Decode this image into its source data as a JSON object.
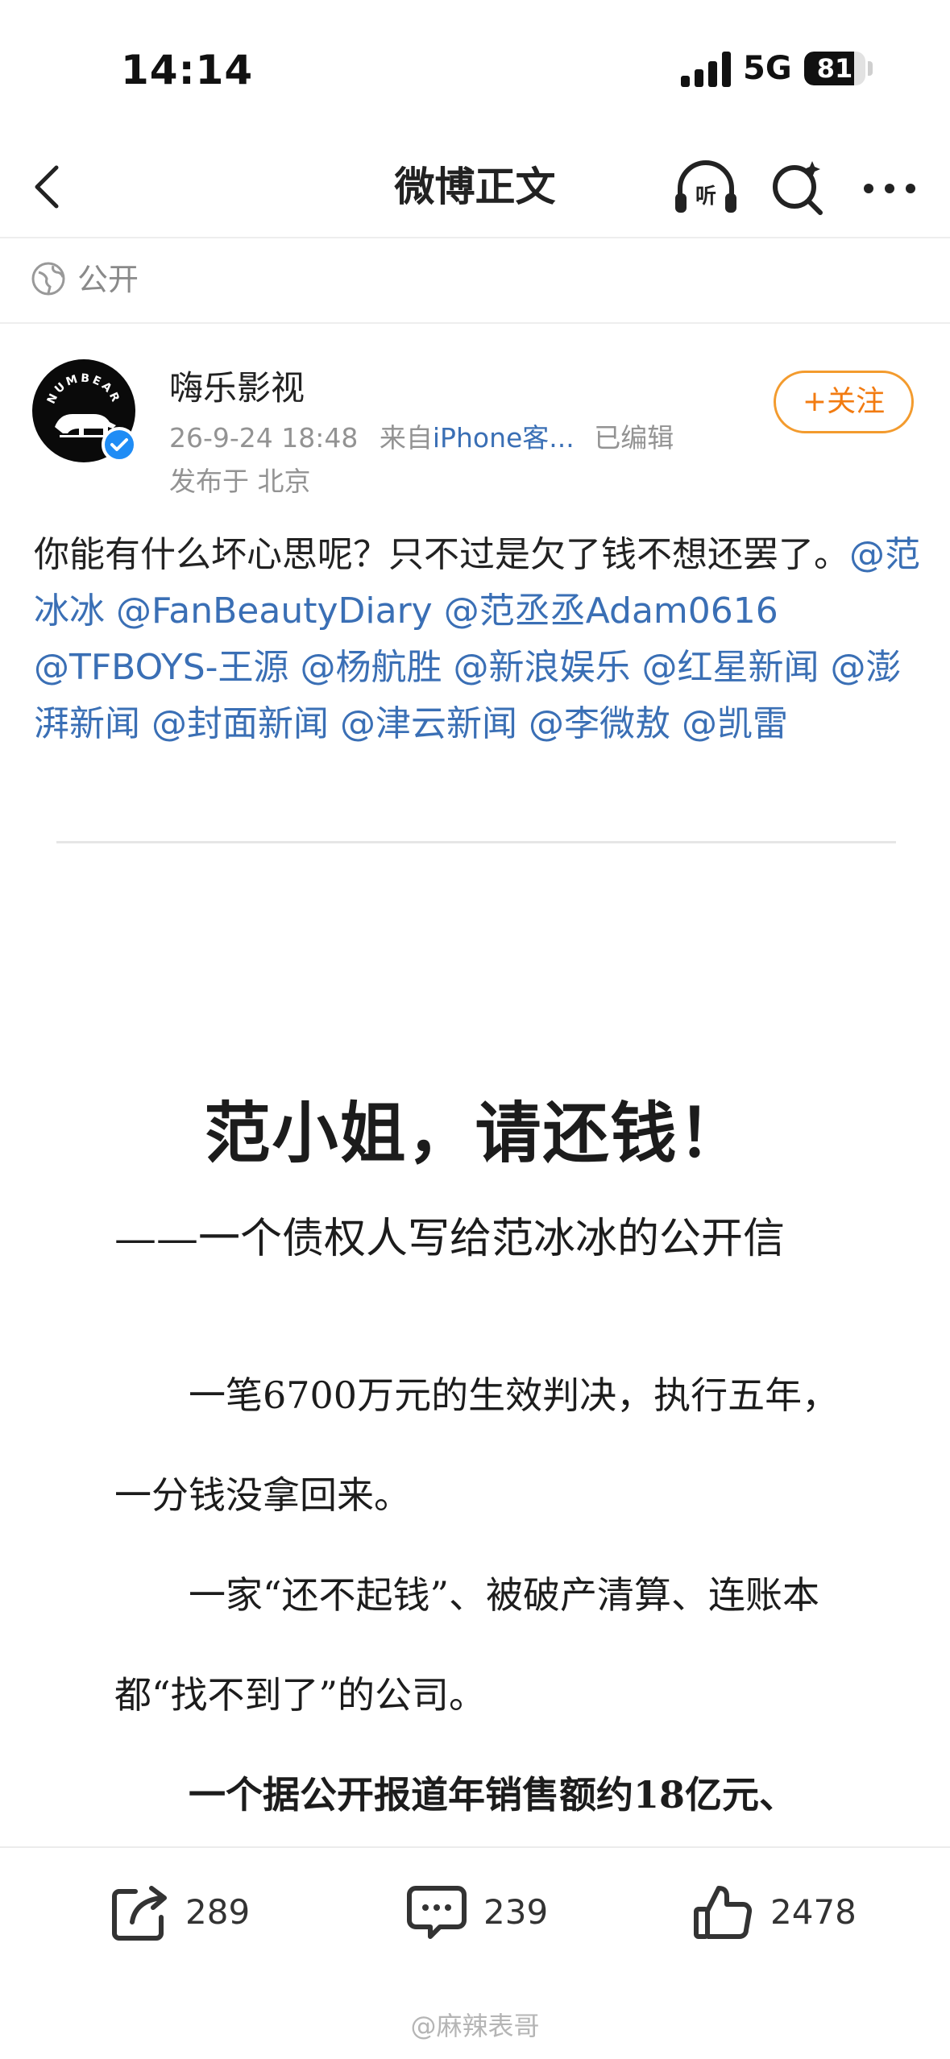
{
  "status_bar": {
    "time": "14:14",
    "network": "5G",
    "battery": "81",
    "battery_level": 0.81
  },
  "nav": {
    "title": "微博正文",
    "listen_label": "听"
  },
  "visibility": {
    "label": "公开"
  },
  "author": {
    "name": "嗨乐影视",
    "avatar_text": "NUMBEAR",
    "date": "26-9-24 18:48",
    "source_prefix": "来自",
    "source": "iPhone客...",
    "edited": "已编辑",
    "location": "发布于 北京",
    "follow_label": "+关注"
  },
  "post": {
    "text": "你能有什么坏心思呢？只不过是欠了钱不想还罢了。",
    "mentions": [
      "@范冰冰",
      "@FanBeautyDiary",
      "@范丞丞Adam0616",
      "@TFBOYS-王源",
      "@杨航胜",
      "@新浪娱乐",
      "@红星新闻",
      "@澎湃新闻",
      "@封面新闻",
      "@津云新闻",
      "@李微敖",
      "@凯雷"
    ]
  },
  "letter": {
    "title": "范小姐，请还钱！",
    "subtitle": "——一个债权人写给范冰冰的公开信",
    "paragraphs": [
      "一笔6700万元的生效判决，执行五年，一分钱没拿回来。",
      "一家“还不起钱”、被破产清算、连账本都“找不到了”的公司。",
      "一个据公开报道年销售额约18亿元、"
    ]
  },
  "toolbar": {
    "repost_count": "289",
    "comment_count": "239",
    "like_count": "2478"
  },
  "watermark": "@麻辣表哥"
}
